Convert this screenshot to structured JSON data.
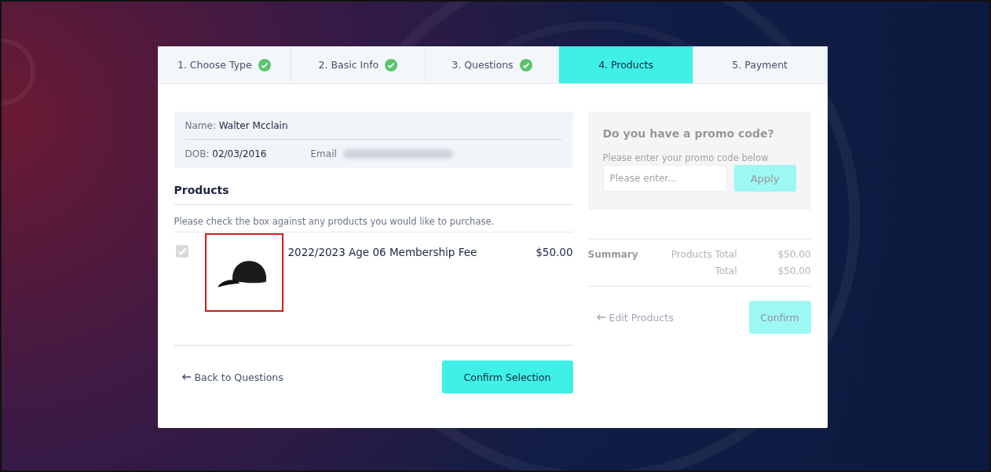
{
  "steps": [
    {
      "label": "1. Choose Type",
      "completed": true,
      "selected": false
    },
    {
      "label": "2. Basic Info",
      "completed": true,
      "selected": false
    },
    {
      "label": "3. Questions",
      "completed": true,
      "selected": false
    },
    {
      "label": "4. Products",
      "completed": false,
      "selected": true
    },
    {
      "label": "5. Payment",
      "completed": false,
      "selected": false
    }
  ],
  "member": {
    "name_label": "Name:",
    "name": "Walter Mcclain",
    "dob_label": "DOB:",
    "dob": "02/03/2016",
    "email_label": "Email"
  },
  "products": {
    "heading": "Products",
    "instruction": "Please check the box against any products you would like to purchase.",
    "items": [
      {
        "name": "2022/2023 Age 06 Membership Fee",
        "price": "$50.00",
        "checked": true,
        "disabled": true
      }
    ]
  },
  "back_link": "Back to Questions",
  "confirm_selection": "Confirm Selection",
  "side_panel": {
    "disabled": true,
    "promo": {
      "title": "Do you have a promo code?",
      "hint": "Please enter your promo code below",
      "placeholder": "Please enter...",
      "apply": "Apply"
    },
    "summary": {
      "label": "Summary",
      "rows": [
        {
          "label": "Products Total",
          "value": "$50.00"
        },
        {
          "label": "Total",
          "value": "$50.00"
        }
      ]
    },
    "edit_link": "Edit Products",
    "confirm": "Confirm"
  }
}
